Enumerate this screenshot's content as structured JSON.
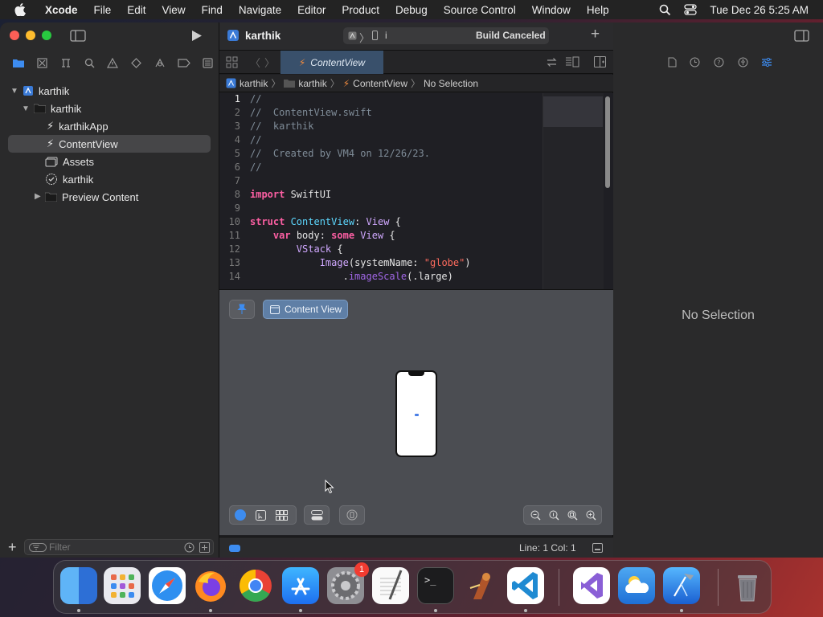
{
  "menubar": {
    "app": "Xcode",
    "items": [
      "File",
      "Edit",
      "View",
      "Find",
      "Navigate",
      "Editor",
      "Product",
      "Debug",
      "Source Control",
      "Window",
      "Help"
    ],
    "clock": "Tue Dec 26  5:25 AM"
  },
  "toolbar": {
    "project": "karthik",
    "scheme_separator": "i",
    "status": "Build Canceled"
  },
  "navigator": {
    "tree": [
      {
        "label": "karthik",
        "level": 0,
        "kind": "project"
      },
      {
        "label": "karthik",
        "level": 1,
        "kind": "folder"
      },
      {
        "label": "karthikApp",
        "level": 2,
        "kind": "swift"
      },
      {
        "label": "ContentView",
        "level": 2,
        "kind": "swift",
        "selected": true
      },
      {
        "label": "Assets",
        "level": 2,
        "kind": "assets"
      },
      {
        "label": "karthik",
        "level": 2,
        "kind": "entitlements"
      },
      {
        "label": "Preview Content",
        "level": 2,
        "kind": "folder"
      }
    ],
    "filter_placeholder": "Filter"
  },
  "editor": {
    "tab": "ContentView",
    "jumpbar": [
      "karthik",
      "karthik",
      "ContentView",
      "No Selection"
    ],
    "line_numbers": [
      "1",
      "2",
      "3",
      "4",
      "5",
      "6",
      "7",
      "8",
      "9",
      "10",
      "11",
      "12",
      "13",
      "14"
    ],
    "code": {
      "l1": "//",
      "l2": "//  ContentView.swift",
      "l3": "//  karthik",
      "l4": "//",
      "l5": "//  Created by VM4 on 12/26/23.",
      "l6": "//",
      "l8_kw": "import",
      "l8_rest": " SwiftUI",
      "l10_kw": "struct",
      "l10_type": " ContentView",
      "l10_colon": ": ",
      "l10_proto": "View",
      "l10_end": " {",
      "l11_kw": "var",
      "l11_name": " body",
      "l11_colon": ": ",
      "l11_kw2": "some",
      "l11_proto": " View",
      "l11_end": " {",
      "l12_type": "VStack",
      "l12_end": " {",
      "l13_type": "Image",
      "l13_open": "(",
      "l13_param": "systemName: ",
      "l13_str": "\"globe\"",
      "l13_close": ")",
      "l14_dot": ".",
      "l14_method": "imageScale",
      "l14_rest": "(.large)"
    }
  },
  "canvas": {
    "preview_button": "Content View"
  },
  "status": {
    "position": "Line: 1  Col: 1"
  },
  "inspector": {
    "empty": "No Selection"
  },
  "dock": {
    "apps": [
      "Finder",
      "Launchpad",
      "Safari",
      "Firefox",
      "Chrome",
      "App Store",
      "System Settings",
      "TextEdit",
      "Terminal",
      "Instruments",
      "Visual Studio Code",
      "Visual Studio",
      "Weather",
      "Xcode",
      "Trash"
    ],
    "badge_system_settings": "1"
  }
}
